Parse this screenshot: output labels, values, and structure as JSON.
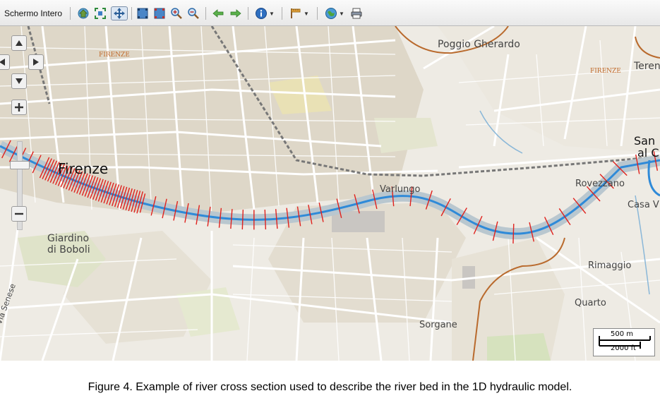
{
  "toolbar": {
    "fullscreen_label": "Schermo Intero",
    "icons": [
      "globe-home-icon",
      "zoom-extent-icon",
      "pan-icon",
      "select-box-icon",
      "select-box-red-icon",
      "zoom-in-icon",
      "zoom-out-icon",
      "back-arrow-icon",
      "forward-arrow-icon",
      "info-icon",
      "measure-icon",
      "layers-icon",
      "print-icon"
    ]
  },
  "map": {
    "labels": {
      "firenze": "Firenze",
      "firenze_mun_1": "FIRENZE",
      "firenze_mun_2": "FIRENZE",
      "poggio": "Poggio Gherardo",
      "terenzano": "Teren",
      "san": "San",
      "al_c": "al C",
      "varlungo": "Varlungo",
      "rovezzano": "Rovezzano",
      "casa": "Casa V",
      "giardino_1": "Giardino",
      "giardino_2": "di Boboli",
      "rimaggio": "Rimaggio",
      "quarto": "Quarto",
      "sorgane": "Sorgane",
      "senese": "Via Senese"
    },
    "scale": {
      "metric": "500 m",
      "imperial": "2000 ft"
    },
    "colors": {
      "river": "#2f8ad8",
      "sections": "#e0211d",
      "boundary": "#b96a2d"
    }
  },
  "caption": "Figure 4. Example of river cross section used to describe the river bed in the 1D hydraulic model."
}
